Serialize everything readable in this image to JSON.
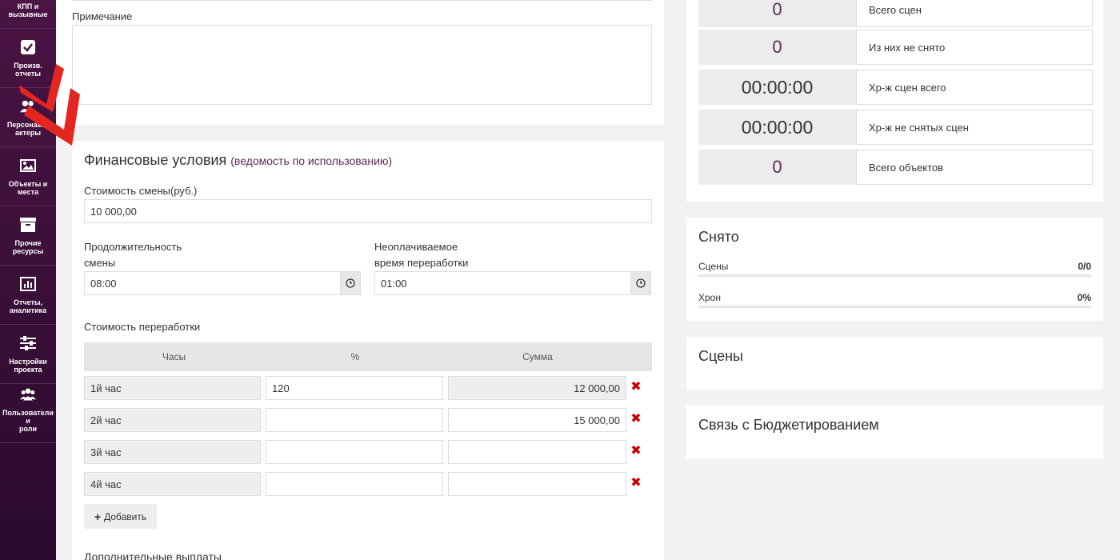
{
  "sidebar": {
    "items": [
      {
        "label": "КПП и\nвызывные",
        "icon": "none"
      },
      {
        "label": "Произв.\nотчеты",
        "icon": "check-square-icon"
      },
      {
        "label": "Персонажи,\nактеры",
        "icon": "users-icon"
      },
      {
        "label": "Объекты и\nместа",
        "icon": "image-icon"
      },
      {
        "label": "Прочие\nресурсы",
        "icon": "archive-icon"
      },
      {
        "label": "Отчеты,\nаналитика",
        "icon": "bar-chart-icon"
      },
      {
        "label": "Настройки\nпроекта",
        "icon": "sliders-icon"
      },
      {
        "label": "Пользователи и\nроли",
        "icon": "group-icon"
      }
    ]
  },
  "note": {
    "label": "Примечание",
    "value": ""
  },
  "finance": {
    "title": "Финансовые условия",
    "link": "(ведомость по использованию)",
    "shift_cost_label": "Стоимость смены(руб.)",
    "shift_cost_value": "10 000,00",
    "duration_label_1": "Продолжительность",
    "duration_label_2": "смены",
    "duration_value": "08:00",
    "unpaid_label_1": "Неоплачиваемое",
    "unpaid_label_2": "время переработки",
    "unpaid_value": "01:00",
    "overtime_label": "Стоимость переработки",
    "table": {
      "headers": [
        "Часы",
        "%",
        "Сумма"
      ],
      "rows": [
        {
          "hour": "1й час",
          "percent": "120",
          "sum": "12 000,00"
        },
        {
          "hour": "2й час",
          "percent": "",
          "sum": "15 000,00"
        },
        {
          "hour": "3й час",
          "percent": "",
          "sum": ""
        },
        {
          "hour": "4й час",
          "percent": "",
          "sum": ""
        }
      ]
    },
    "add_label": "Добавить",
    "extra_label": "Дополнительные выплаты"
  },
  "stats": [
    {
      "value": "0",
      "label": "Всего сцен"
    },
    {
      "value": "0",
      "label": "Из них не снято"
    },
    {
      "value": "00:00:00",
      "label": "Хр-ж сцен всего"
    },
    {
      "value": "00:00:00",
      "label": "Хр-ж не снятых сцен"
    },
    {
      "value": "0",
      "label": "Всего объектов"
    }
  ],
  "shot": {
    "title": "Снято",
    "scenes_label": "Сцены",
    "scenes_value": "0/0",
    "scenes_progress": 0,
    "chron_label": "Хрон",
    "chron_value": "0%",
    "chron_progress": 0
  },
  "scenes_panel": {
    "title": "Сцены"
  },
  "budget_panel": {
    "title": "Связь с Бюджетированием"
  },
  "colors": {
    "accent": "#5a2a56",
    "sidebar": "#4a1444",
    "delete": "#cc0000"
  }
}
